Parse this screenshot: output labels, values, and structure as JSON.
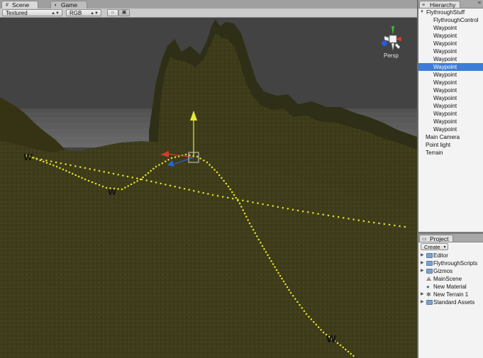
{
  "tabs": {
    "scene": "Scene",
    "game": "Game"
  },
  "toolbar": {
    "render_mode": "Textured",
    "color_mode": "RGB",
    "lighting_icon": "sun-icon",
    "image_icon": "image-icon"
  },
  "gizmo": {
    "label": "Persp"
  },
  "hierarchy": {
    "title": "Hierarchy",
    "items": [
      {
        "label": "FlythroughStuff",
        "depth": 0,
        "expandable": true,
        "selected": false
      },
      {
        "label": "FlythroughControl",
        "depth": 1,
        "expandable": false,
        "selected": false
      },
      {
        "label": "Waypoint",
        "depth": 1,
        "expandable": false,
        "selected": false
      },
      {
        "label": "Waypoint",
        "depth": 1,
        "expandable": false,
        "selected": false
      },
      {
        "label": "Waypoint",
        "depth": 1,
        "expandable": false,
        "selected": false
      },
      {
        "label": "Waypoint",
        "depth": 1,
        "expandable": false,
        "selected": false
      },
      {
        "label": "Waypoint",
        "depth": 1,
        "expandable": false,
        "selected": false
      },
      {
        "label": "Waypoint",
        "depth": 1,
        "expandable": false,
        "selected": true
      },
      {
        "label": "Waypoint",
        "depth": 1,
        "expandable": false,
        "selected": false
      },
      {
        "label": "Waypoint",
        "depth": 1,
        "expandable": false,
        "selected": false
      },
      {
        "label": "Waypoint",
        "depth": 1,
        "expandable": false,
        "selected": false
      },
      {
        "label": "Waypoint",
        "depth": 1,
        "expandable": false,
        "selected": false
      },
      {
        "label": "Waypoint",
        "depth": 1,
        "expandable": false,
        "selected": false
      },
      {
        "label": "Waypoint",
        "depth": 1,
        "expandable": false,
        "selected": false
      },
      {
        "label": "Waypoint",
        "depth": 1,
        "expandable": false,
        "selected": false
      },
      {
        "label": "Waypoint",
        "depth": 1,
        "expandable": false,
        "selected": false
      },
      {
        "label": "Main Camera",
        "depth": 0,
        "expandable": false,
        "selected": false
      },
      {
        "label": "Point light",
        "depth": 0,
        "expandable": false,
        "selected": false
      },
      {
        "label": "Terrain",
        "depth": 0,
        "expandable": false,
        "selected": false
      }
    ]
  },
  "project": {
    "title": "Project",
    "create_label": "Create",
    "items": [
      {
        "label": "Editor",
        "icon": "folder-icon",
        "expandable": true
      },
      {
        "label": "FlythroughScripts",
        "icon": "folder-icon",
        "expandable": true
      },
      {
        "label": "Gizmos",
        "icon": "folder-icon",
        "expandable": true
      },
      {
        "label": "MainScene",
        "icon": "unity-scene-icon",
        "expandable": false
      },
      {
        "label": "New Material",
        "icon": "material-sphere-icon",
        "expandable": false
      },
      {
        "label": "New Terrain 1",
        "icon": "terrain-icon",
        "expandable": true
      },
      {
        "label": "Standard Assets",
        "icon": "folder-icon",
        "expandable": true
      }
    ]
  },
  "colors": {
    "selection": "#3d7dd8",
    "path": "#e6e22a",
    "terrain": "#3e3c1a",
    "sky": "#424242"
  }
}
